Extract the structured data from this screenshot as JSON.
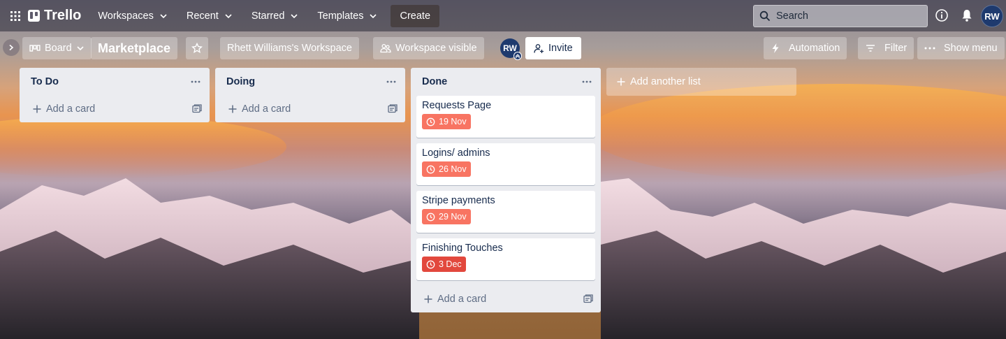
{
  "topnav": {
    "logo": "Trello",
    "menus": [
      "Workspaces",
      "Recent",
      "Starred",
      "Templates"
    ],
    "create_label": "Create",
    "search_placeholder": "Search",
    "avatar_initials": "RW"
  },
  "board_header": {
    "view_label": "Board",
    "board_title": "Marketplace",
    "workspace_label": "Rhett Williams's Workspace",
    "visibility_label": "Workspace visible",
    "member_initials": "RW",
    "invite_label": "Invite",
    "automation_label": "Automation",
    "filter_label": "Filter",
    "show_menu_label": "Show menu"
  },
  "lists": [
    {
      "title": "To Do",
      "add_card_label": "Add a card",
      "cards": []
    },
    {
      "title": "Doing",
      "add_card_label": "Add a card",
      "cards": []
    },
    {
      "title": "Done",
      "add_card_label": "Add a card",
      "cards": [
        {
          "title": "Requests Page",
          "due": "19 Nov",
          "status": "due-soon"
        },
        {
          "title": "Logins/ admins",
          "due": "26 Nov",
          "status": "due-soon"
        },
        {
          "title": "Stripe payments",
          "due": "29 Nov",
          "status": "due-soon"
        },
        {
          "title": "Finishing Touches",
          "due": "3 Dec",
          "status": "overdue"
        }
      ]
    }
  ],
  "add_list_label": "Add another list",
  "colors": {
    "due_soon": "#f87462",
    "overdue": "#e2483d",
    "list_bg": "#ebecf0",
    "avatar": "#1e3a6e"
  }
}
